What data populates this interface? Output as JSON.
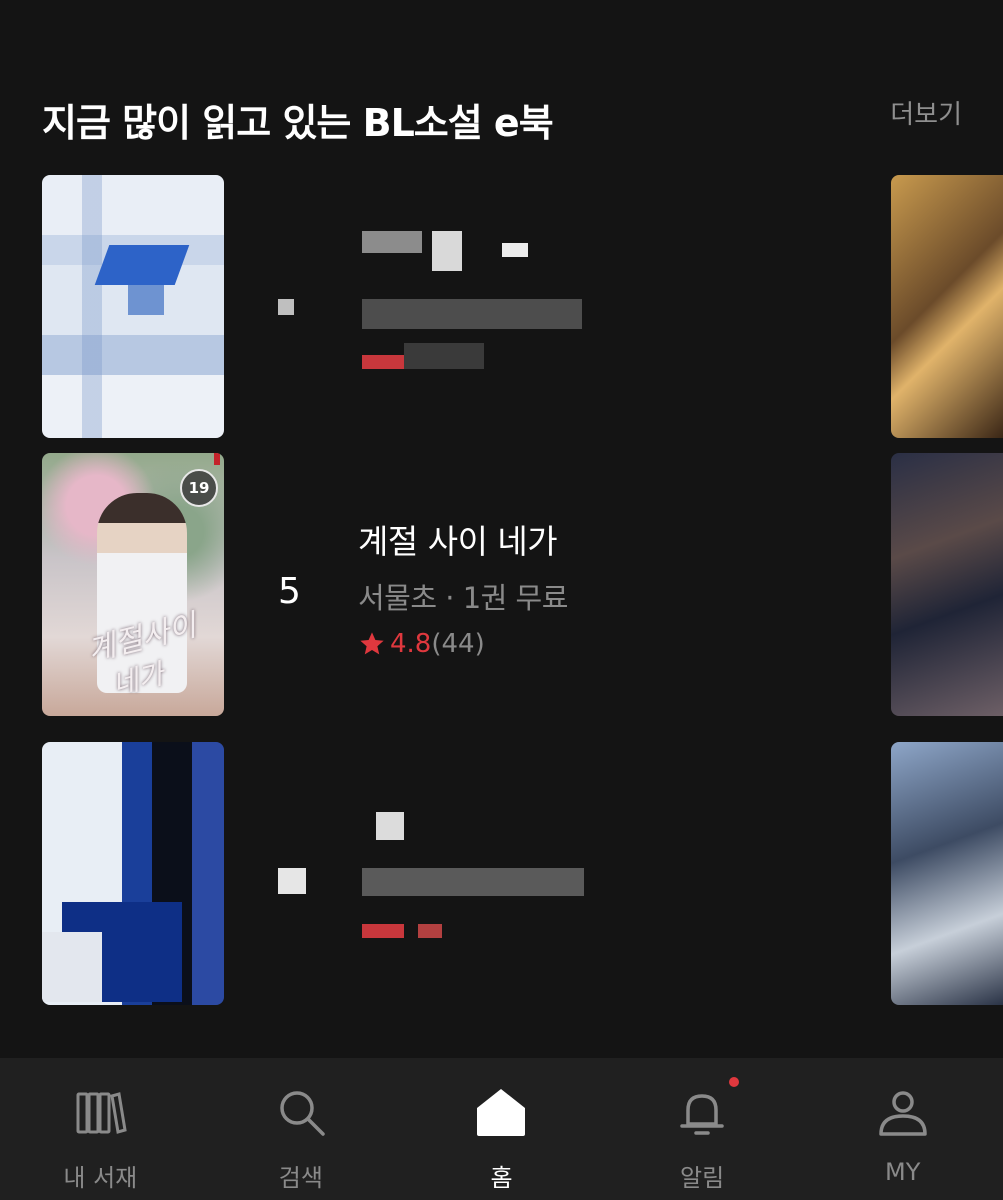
{
  "section": {
    "title": "지금 많이 읽고 있는 BL소설 e북",
    "more_label": "더보기"
  },
  "featured_book": {
    "rank": "5",
    "title": "계절 사이 네가",
    "meta": "서물초 · 1권 무료",
    "rating_value": "4.8",
    "rating_count": "(44)",
    "age_badge": "19",
    "cover_title_line1": "계절사이",
    "cover_title_line2": "네가"
  },
  "bottom_nav": {
    "items": [
      {
        "label": "내 서재",
        "icon": "bookshelf-icon"
      },
      {
        "label": "검색",
        "icon": "search-icon"
      },
      {
        "label": "홈",
        "icon": "home-icon"
      },
      {
        "label": "알림",
        "icon": "bell-icon"
      },
      {
        "label": "MY",
        "icon": "person-icon"
      }
    ],
    "active_index": 2
  },
  "colors": {
    "background": "#141414",
    "nav_background": "#202020",
    "accent_red": "#e0383e",
    "muted_text": "#8a8a8a"
  }
}
